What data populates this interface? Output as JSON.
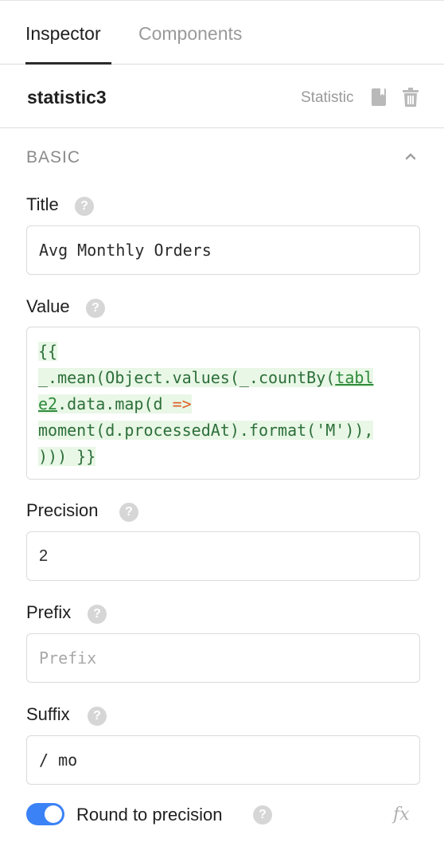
{
  "tabs": {
    "inspector": "Inspector",
    "components": "Components"
  },
  "header": {
    "component_name": "statistic3",
    "component_type": "Statistic",
    "doc_icon": "book-icon",
    "delete_icon": "trash-icon"
  },
  "section": {
    "title": "BASIC",
    "collapse_icon": "chevron-up-icon"
  },
  "fields": {
    "title": {
      "label": "Title",
      "value": "Avg Monthly Orders"
    },
    "value": {
      "label": "Value",
      "code_lines": [
        "{{",
        "_.mean(Object.values(_.countBy(",
        "tabl",
        "e2",
        ".data.map(d ",
        "=>",
        "moment(d.processedAt).format('M')),",
        "))) }}"
      ]
    },
    "precision": {
      "label": "Precision",
      "value": "2"
    },
    "prefix": {
      "label": "Prefix",
      "value": "",
      "placeholder": "Prefix"
    },
    "suffix": {
      "label": "Suffix",
      "value": "/ mo"
    }
  },
  "round_to_precision": {
    "label": "Round to precision",
    "enabled": true,
    "fx_label": "fx"
  },
  "help_glyph": "?",
  "colors": {
    "toggle_on": "#3b82f6",
    "code_text": "#2c6f3a",
    "code_bg": "#e9f7e6",
    "arrow": "#e0602b"
  }
}
